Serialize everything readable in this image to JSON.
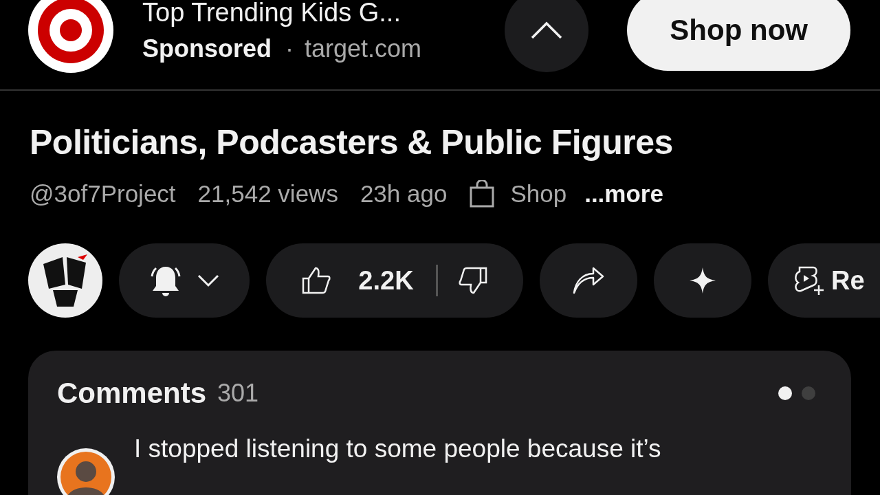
{
  "ad": {
    "title": "Top Trending Kids G...",
    "label": "Sponsored",
    "separator": "·",
    "domain": "target.com",
    "cta": "Shop now"
  },
  "video": {
    "title": "Politicians, Podcasters & Public Figures",
    "channel": "@3of7Project",
    "views": "21,542 views",
    "age": "23h ago",
    "shop": "Shop",
    "more": "...more"
  },
  "actions": {
    "likes": "2.2K",
    "remix": "Re"
  },
  "comments": {
    "title": "Comments",
    "count": "301",
    "pages": [
      {
        "selected": true
      },
      {
        "selected": false
      }
    ],
    "first": "I stopped listening to some people because it’s"
  }
}
